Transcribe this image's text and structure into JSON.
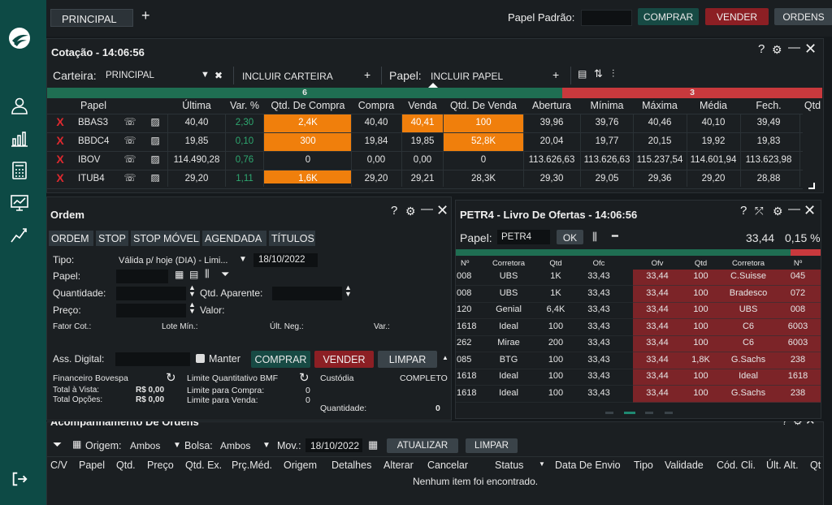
{
  "top": {
    "tab_label": "PRINCIPAL",
    "add_tab": "+",
    "papel_padrao_label": "Papel Padrão:",
    "comprar": "COMPRAR",
    "vender": "VENDER",
    "ordens": "ORDENS"
  },
  "cotacao": {
    "title": "Cotação - 14:06:56",
    "carteira_label": "Carteira:",
    "carteira_value": "PRINCIPAL",
    "incluir_carteira": "INCLUIR CARTEIRA",
    "papel_label": "Papel:",
    "incluir_papel": "INCLUIR PAPEL",
    "count_up": "6",
    "count_down": "3",
    "headers": [
      "Papel",
      "Última",
      "Var. %",
      "Qtd. De Compra",
      "Compra",
      "Venda",
      "Qtd. De Venda",
      "Abertura",
      "Mínima",
      "Máxima",
      "Média",
      "Fech.",
      "Qtd"
    ],
    "rows": [
      {
        "papel": "BBAS3",
        "ultima": "40,40",
        "var": "2,30",
        "qcompra": "2,4K",
        "compra": "40,40",
        "venda": "40,41",
        "qvenda": "100",
        "abertura": "39,96",
        "minima": "39,76",
        "maxima": "40,46",
        "media": "40,10",
        "fech": "39,49"
      },
      {
        "papel": "BBDC4",
        "ultima": "19,85",
        "var": "0,10",
        "qcompra": "300",
        "compra": "19,84",
        "venda": "19,85",
        "qvenda": "52,8K",
        "abertura": "20,04",
        "minima": "19,77",
        "maxima": "20,15",
        "media": "19,92",
        "fech": "19,83"
      },
      {
        "papel": "IBOV",
        "ultima": "114.490,28",
        "var": "0,76",
        "qcompra": "0",
        "compra": "0,00",
        "venda": "0,00",
        "qvenda": "0",
        "abertura": "113.626,63",
        "minima": "113.626,63",
        "maxima": "115.237,54",
        "media": "114.601,94",
        "fech": "113.623,98"
      },
      {
        "papel": "ITUB4",
        "ultima": "29,20",
        "var": "1,11",
        "qcompra": "1,6K",
        "compra": "29,20",
        "venda": "29,21",
        "qvenda": "28,3K",
        "abertura": "29,30",
        "minima": "29,05",
        "maxima": "29,36",
        "media": "29,20",
        "fech": "28,88"
      }
    ],
    "remove_mark": "X"
  },
  "ordem": {
    "title": "Ordem",
    "tabs": [
      "ORDEM",
      "STOP",
      "STOP MÓVEL",
      "AGENDADA",
      "TÍTULOS"
    ],
    "tipo_label": "Tipo:",
    "tipo_value": "Válida p/ hoje (DIA) - Limi...",
    "date": "18/10/2022",
    "papel_label": "Papel:",
    "quantidade_label": "Quantidade:",
    "qtd_aparente_label": "Qtd. Aparente:",
    "preco_label": "Preço:",
    "valor_label": "Valor:",
    "fator_cot": "Fator Cot.:",
    "lote_min": "Lote Mín.:",
    "ult_neg": "Últ. Neg.:",
    "var": "Var.:",
    "ass_digital": "Ass. Digital:",
    "manter": "Manter",
    "comprar": "COMPRAR",
    "vender": "VENDER",
    "limpar": "LIMPAR",
    "financeiro": "Financeiro Bovespa",
    "limite_bmf": "Limite Quantitativo BMF",
    "custodia": "Custódia",
    "completo": "COMPLETO",
    "total_vista_label": "Total à Vista:",
    "total_vista_value": "R$ 0,00",
    "total_opcoes_label": "Total Opções:",
    "total_opcoes_value": "R$ 0,00",
    "lim_compra_label": "Limite para Compra:",
    "lim_compra_value": "0",
    "lim_venda_label": "Limite para Venda:",
    "lim_venda_value": "0",
    "quantidade2_label": "Quantidade:",
    "quantidade2_value": "0"
  },
  "livro": {
    "title": "PETR4 - Livro De Ofertas - 14:06:56",
    "papel_label": "Papel:",
    "papel_value": "PETR4",
    "ok": "OK",
    "price": "33,44",
    "pct": "0,15 %",
    "headers": [
      "Nº",
      "Corretora",
      "Qtd",
      "Ofc",
      "Ofv",
      "Qtd",
      "Corretora",
      "Nº"
    ],
    "rows": [
      [
        "008",
        "UBS",
        "1K",
        "33,43",
        "33,44",
        "100",
        "C.Suisse",
        "045"
      ],
      [
        "008",
        "UBS",
        "1K",
        "33,43",
        "33,44",
        "100",
        "Bradesco",
        "072"
      ],
      [
        "120",
        "Genial",
        "6,4K",
        "33,43",
        "33,44",
        "100",
        "UBS",
        "008"
      ],
      [
        "1618",
        "Ideal",
        "100",
        "33,43",
        "33,44",
        "100",
        "C6",
        "6003"
      ],
      [
        "262",
        "Mirae",
        "200",
        "33,43",
        "33,44",
        "100",
        "C6",
        "6003"
      ],
      [
        "085",
        "BTG",
        "100",
        "33,43",
        "33,44",
        "1,8K",
        "G.Sachs",
        "238"
      ],
      [
        "1618",
        "Ideal",
        "100",
        "33,43",
        "33,44",
        "100",
        "Ideal",
        "1618"
      ],
      [
        "1618",
        "Ideal",
        "100",
        "33,43",
        "33,44",
        "100",
        "G.Sachs",
        "238"
      ]
    ]
  },
  "acomp": {
    "title": "Acompanhamento De Ordens",
    "origem_label": "Origem:",
    "origem_value": "Ambos",
    "bolsa_label": "Bolsa:",
    "bolsa_value": "Ambos",
    "mov_label": "Mov.:",
    "mov_value": "18/10/2022",
    "atualizar": "ATUALIZAR",
    "limpar": "LIMPAR",
    "headers": [
      "C/V",
      "Papel",
      "Qtd.",
      "Preço",
      "Qtd. Ex.",
      "Prç.Méd.",
      "Origem",
      "Detalhes",
      "Alterar",
      "Cancelar",
      "Status",
      "Data De Envio",
      "Tipo",
      "Validade",
      "Cód. Cli.",
      "Últ. Alt.",
      "Qt"
    ],
    "empty": "Nenhum item foi encontrado."
  },
  "colors": {
    "accent": "#0d4a45",
    "orange": "#f07f0c",
    "red_bar": "#c8393d",
    "green_bar": "#1f6e52"
  }
}
